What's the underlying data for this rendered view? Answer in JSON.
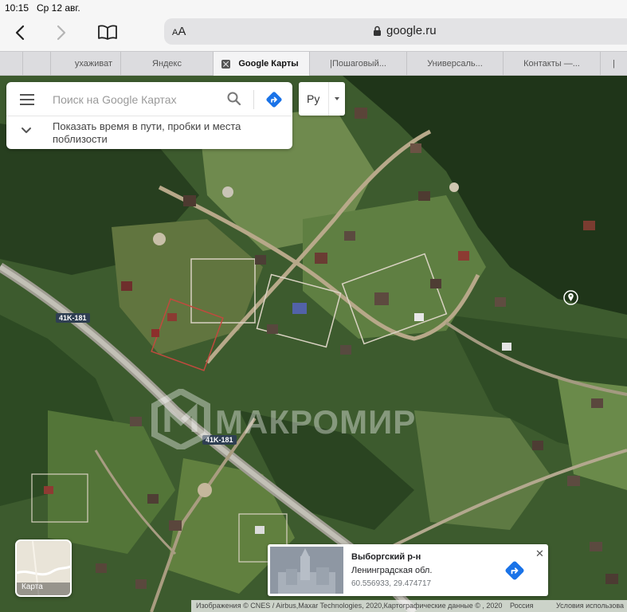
{
  "status_bar": {
    "time": "10:15",
    "date": "Ср 12 авг."
  },
  "toolbar": {
    "text_size_label_small": "A",
    "text_size_label_big": "A",
    "host": "google.ru"
  },
  "tabs": [
    {
      "label": ""
    },
    {
      "label": ""
    },
    {
      "label": "ухаживат"
    },
    {
      "label": "Яндекс"
    },
    {
      "label": "Google Карты",
      "active": true
    },
    {
      "label": "|Пошаговый..."
    },
    {
      "label": "Универсаль..."
    },
    {
      "label": "Контакты —..."
    },
    {
      "label": "|"
    }
  ],
  "search": {
    "placeholder": "Поиск на Google Картах",
    "hint": "Показать время в пути, пробки и места поблизости"
  },
  "language": {
    "label": "Ру"
  },
  "map": {
    "road_labels": [
      "41K-181",
      "41K-181"
    ],
    "watermark": "МАКРОМИР"
  },
  "layers": {
    "label": "Карта"
  },
  "place_card": {
    "title": "Выборгский р-н",
    "region": "Ленинградская обл.",
    "coordinates": "60.556933, 29.474717"
  },
  "footer": {
    "imagery": "Изображения © CNES / Airbus,Maxar Technologies, 2020,Картографические данные © , 2020",
    "country": "Россия",
    "terms": "Условия использова"
  },
  "colors": {
    "accent": "#1a73e8",
    "road_label_bg": "#2f3f52"
  }
}
